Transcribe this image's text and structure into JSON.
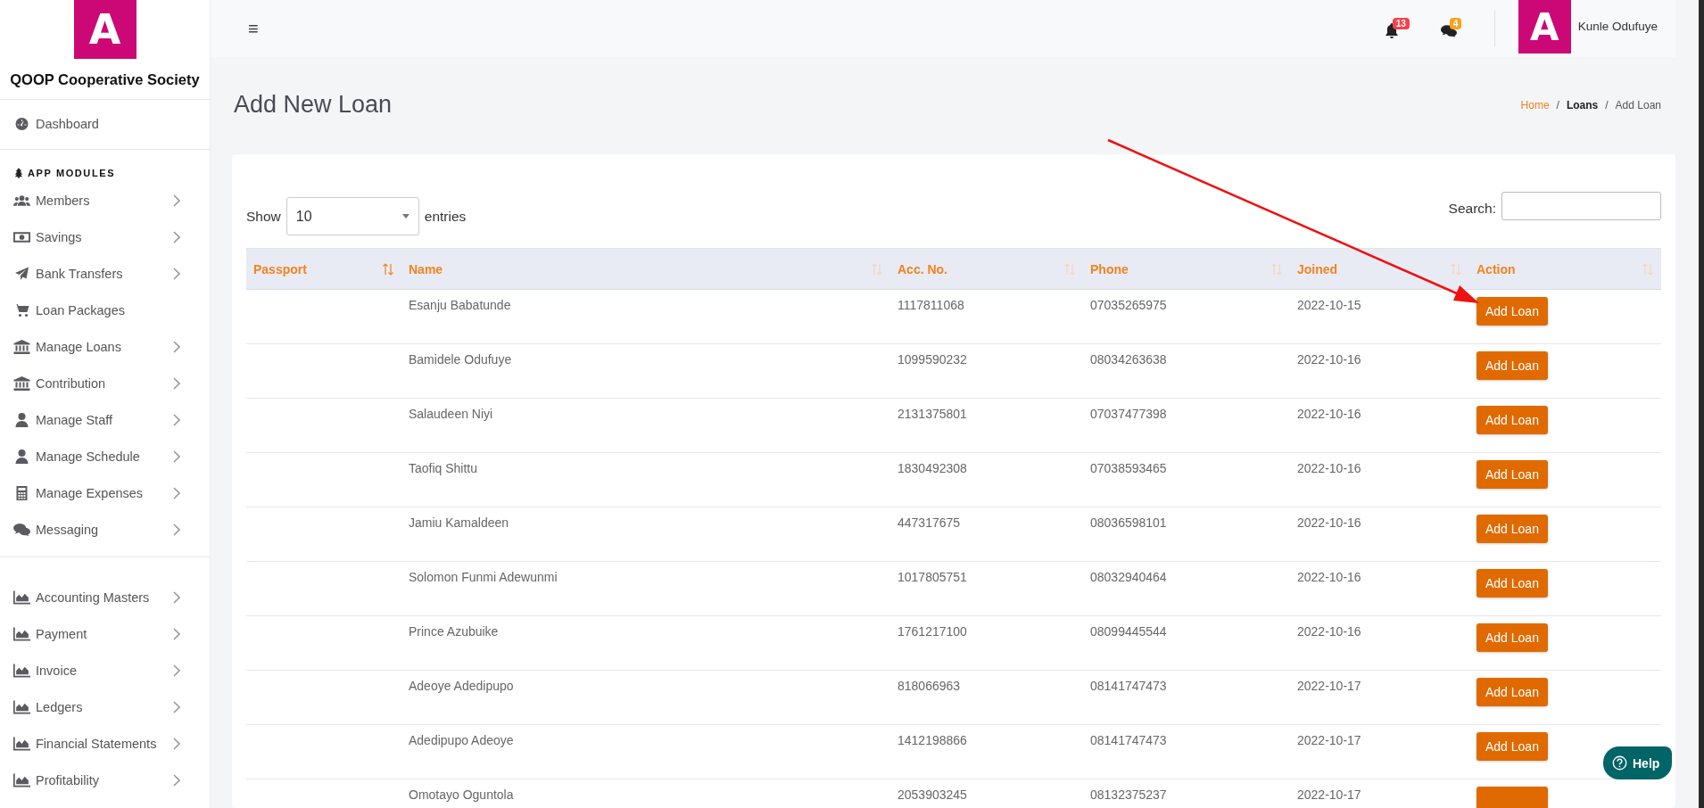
{
  "sidebar": {
    "logo_letter": "A",
    "org_name": "QOOP Cooperative Society",
    "top_item": {
      "label": "Dashboard"
    },
    "section_heading": "APP MODULES",
    "groups": [
      [
        {
          "label": "Members",
          "has_submenu": true
        },
        {
          "label": "Savings",
          "has_submenu": true
        },
        {
          "label": "Bank Transfers",
          "has_submenu": true
        },
        {
          "label": "Loan Packages",
          "has_submenu": false
        },
        {
          "label": "Manage Loans",
          "has_submenu": true
        },
        {
          "label": "Contribution",
          "has_submenu": true
        },
        {
          "label": "Manage Staff",
          "has_submenu": true
        },
        {
          "label": "Manage Schedule",
          "has_submenu": true
        },
        {
          "label": "Manage Expenses",
          "has_submenu": true
        },
        {
          "label": "Messaging",
          "has_submenu": true
        }
      ],
      [
        {
          "label": "Accounting Masters",
          "has_submenu": true
        },
        {
          "label": "Payment",
          "has_submenu": true
        },
        {
          "label": "Invoice",
          "has_submenu": true
        },
        {
          "label": "Ledgers",
          "has_submenu": true
        },
        {
          "label": "Financial Statements",
          "has_submenu": true
        },
        {
          "label": "Profitability",
          "has_submenu": true
        }
      ]
    ]
  },
  "topbar": {
    "menu_glyph": "≡",
    "notifications": "13",
    "messages": "4",
    "avatar_letter": "A",
    "user_name": "Kunle Odufuye"
  },
  "page_title": "Add New Loan",
  "breadcrumb_separator": "/",
  "breadcrumb": [
    {
      "label": "Home",
      "kind": "link"
    },
    {
      "label": "Loans",
      "kind": "parent"
    },
    {
      "label": "Add Loan",
      "kind": "current"
    }
  ],
  "table_controls": {
    "show_label": "Show",
    "page_size": "10",
    "entries_label": "entries",
    "search_label": "Search:"
  },
  "table": {
    "columns": [
      {
        "label": "Passport",
        "sorted": true
      },
      {
        "label": "Name",
        "sorted": false
      },
      {
        "label": "Acc. No.",
        "sorted": false
      },
      {
        "label": "Phone",
        "sorted": false
      },
      {
        "label": "Joined",
        "sorted": false
      },
      {
        "label": "Action",
        "sorted": false
      }
    ],
    "rows": [
      {
        "name": "Esanju Babatunde",
        "acc_no": "1117811068",
        "phone": "07035265975",
        "joined": "2022-10-15",
        "action": "Add Loan"
      },
      {
        "name": "Bamidele Odufuye",
        "acc_no": "1099590232",
        "phone": "08034263638",
        "joined": "2022-10-16",
        "action": "Add Loan"
      },
      {
        "name": "Salaudeen Niyi",
        "acc_no": "2131375801",
        "phone": "07037477398",
        "joined": "2022-10-16",
        "action": "Add Loan"
      },
      {
        "name": "Taofiq Shittu",
        "acc_no": "1830492308",
        "phone": "07038593465",
        "joined": "2022-10-16",
        "action": "Add Loan"
      },
      {
        "name": "Jamiu Kamaldeen",
        "acc_no": "447317675",
        "phone": "08036598101",
        "joined": "2022-10-16",
        "action": "Add Loan"
      },
      {
        "name": "Solomon Funmi Adewunmi",
        "acc_no": "1017805751",
        "phone": "08032940464",
        "joined": "2022-10-16",
        "action": "Add Loan"
      },
      {
        "name": "Prince Azubuike",
        "acc_no": "1761217100",
        "phone": "08099445544",
        "joined": "2022-10-16",
        "action": "Add Loan"
      },
      {
        "name": "Adeoye Adedipupo",
        "acc_no": "818066963",
        "phone": "08141747473",
        "joined": "2022-10-17",
        "action": "Add Loan"
      },
      {
        "name": "Adedipupo Adeoye",
        "acc_no": "1412198866",
        "phone": "08141747473",
        "joined": "2022-10-17",
        "action": "Add Loan"
      },
      {
        "name": "Omotayo Oguntola",
        "acc_no": "2053903245",
        "phone": "08132375237",
        "joined": "2022-10-17"
      }
    ]
  },
  "help_button": {
    "label": "Help"
  },
  "annotations": [
    {
      "kind": "arrow"
    }
  ]
}
